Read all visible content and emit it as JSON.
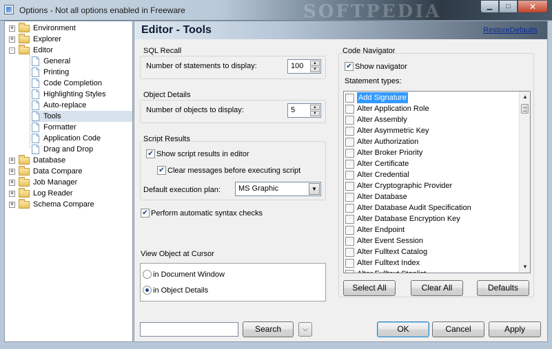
{
  "window": {
    "title": "Options - Not all options enabled in Freeware",
    "watermark": "SOFTPEDIA",
    "minimize_icon": "minimize-icon",
    "maximize_icon": "maximize-icon",
    "close_icon": "close-icon"
  },
  "tree": {
    "items": [
      {
        "label": "Environment",
        "type": "folder",
        "expander": "+"
      },
      {
        "label": "Explorer",
        "type": "folder",
        "expander": "+"
      },
      {
        "label": "Editor",
        "type": "folder-open",
        "expander": "-"
      },
      {
        "label": "General",
        "type": "doc"
      },
      {
        "label": "Printing",
        "type": "doc"
      },
      {
        "label": "Code Completion",
        "type": "doc"
      },
      {
        "label": "Highlighting Styles",
        "type": "doc"
      },
      {
        "label": "Auto-replace",
        "type": "doc"
      },
      {
        "label": "Tools",
        "type": "doc",
        "selected": true
      },
      {
        "label": "Formatter",
        "type": "doc"
      },
      {
        "label": "Application Code",
        "type": "doc"
      },
      {
        "label": "Drag and Drop",
        "type": "doc"
      },
      {
        "label": "Database",
        "type": "folder",
        "expander": "+"
      },
      {
        "label": "Data Compare",
        "type": "folder",
        "expander": "+"
      },
      {
        "label": "Job Manager",
        "type": "folder",
        "expander": "+"
      },
      {
        "label": "Log Reader",
        "type": "folder",
        "expander": "+"
      },
      {
        "label": "Schema Compare",
        "type": "folder",
        "expander": "+"
      }
    ]
  },
  "header": {
    "title": "Editor - Tools",
    "restore_link": "RestoreDefaults"
  },
  "sql_recall": {
    "title": "SQL Recall",
    "label": "Number of statements to display:",
    "value": "100"
  },
  "object_details": {
    "title": "Object Details",
    "label": "Number of objects to display:",
    "value": "5"
  },
  "script_results": {
    "title": "Script Results",
    "show_results": "Show script results in editor",
    "clear_messages": "Clear messages before executing script",
    "plan_label": "Default execution plan:",
    "plan_value": "MS Graphic"
  },
  "syntax_checks": "Perform automatic syntax checks",
  "view_object": {
    "title": "View Object at Cursor",
    "option_document": "in Document Window",
    "option_details": "in Object Details"
  },
  "code_navigator": {
    "title": "Code Navigator",
    "show_navigator": "Show navigator",
    "statement_types": "Statement types:",
    "statements": [
      "Add Signature",
      "Alter Application Role",
      "Alter Assembly",
      "Alter Asymmetric Key",
      "Alter Authorization",
      "Alter Broker Priority",
      "Alter Certificate",
      "Alter Credential",
      "Alter Cryptographic Provider",
      "Alter Database",
      "Alter Database Audit Specification",
      "Alter Database Encryption Key",
      "Alter Endpoint",
      "Alter Event Session",
      "Alter Fulltext Catalog",
      "Alter Fulltext Index",
      "Alter Fulltext Stoplist"
    ],
    "select_all": "Select All",
    "clear_all": "Clear All",
    "defaults": "Defaults"
  },
  "footer": {
    "search_button": "Search",
    "ok": "OK",
    "cancel": "Cancel",
    "apply": "Apply"
  }
}
